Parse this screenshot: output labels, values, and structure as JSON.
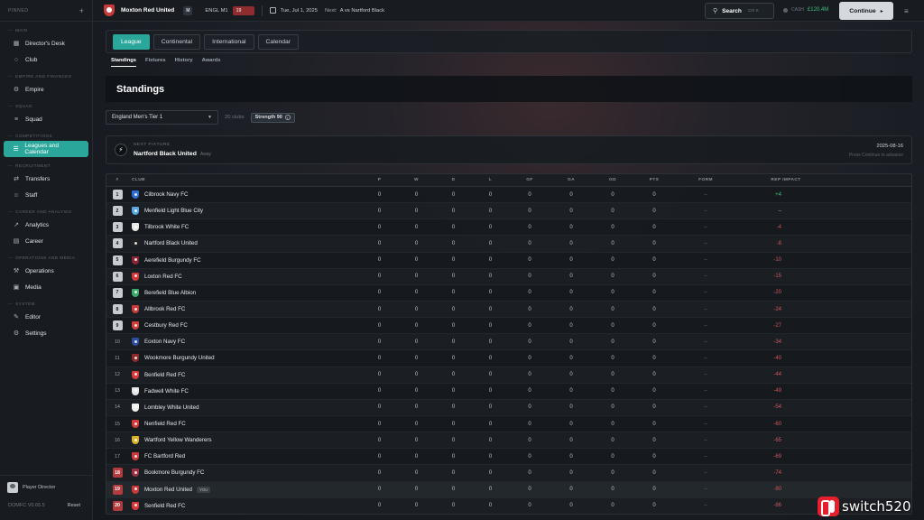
{
  "sidebar": {
    "pinned_label": "PINNED",
    "groups": [
      {
        "section": "MAIN",
        "items": [
          {
            "label": "Director's Desk",
            "icon": "grid-icon"
          },
          {
            "label": "Club",
            "icon": "pin-icon"
          }
        ]
      },
      {
        "section": "EMPIRE AND FINANCES",
        "items": [
          {
            "label": "Empire",
            "icon": "gear-icon"
          }
        ]
      },
      {
        "section": "SQUAD",
        "items": [
          {
            "label": "Squad",
            "icon": "chart-icon"
          }
        ]
      },
      {
        "section": "COMPETITIONS",
        "items": [
          {
            "label": "Leagues and Calendar",
            "icon": "list-icon",
            "active": true
          }
        ]
      },
      {
        "section": "RECRUITMENT",
        "items": [
          {
            "label": "Transfers",
            "icon": "transfer-icon"
          },
          {
            "label": "Staff",
            "icon": "staff-icon"
          }
        ]
      },
      {
        "section": "CAREER AND ANALYSIS",
        "items": [
          {
            "label": "Analytics",
            "icon": "analytics-icon"
          },
          {
            "label": "Career",
            "icon": "career-icon"
          }
        ]
      },
      {
        "section": "OPERATIONS AND MEDIA",
        "items": [
          {
            "label": "Operations",
            "icon": "operations-icon"
          },
          {
            "label": "Media",
            "icon": "media-icon"
          }
        ]
      },
      {
        "section": "SYSTEM",
        "items": [
          {
            "label": "Editor",
            "icon": "edit-icon"
          },
          {
            "label": "Settings",
            "icon": "gear-icon"
          }
        ]
      }
    ],
    "user_name": "Player Director",
    "version": "DOMFC V0.65.5",
    "reset_label": "Reset"
  },
  "topbar": {
    "club": "Moxton Red United",
    "badge": "M",
    "league": "ENGL M1",
    "position": "19",
    "date": "Tue, Jul 1, 2025",
    "next_label": "Next:",
    "next_value": "A  vs Nartford Black",
    "search_label": "Search",
    "search_kbd": "Ctrl K",
    "cash_label": "CASH",
    "cash_value": "£120.4M",
    "continue_label": "Continue"
  },
  "tabs": [
    "League",
    "Continental",
    "International",
    "Calendar"
  ],
  "subtabs": [
    "Standings",
    "Fixtures",
    "History",
    "Awards"
  ],
  "page_title": "Standings",
  "filter": {
    "league": "England Men's Tier 1",
    "clubs": "20 clubs",
    "strength": "Strength 90"
  },
  "fixture": {
    "label": "NEXT FIXTURE",
    "team": "Nartford Black United",
    "venue": "Away",
    "date": "2025-08-16",
    "hint": "Press Continue to advance"
  },
  "table": {
    "headers": {
      "pos": "#",
      "club": "CLUB",
      "p": "P",
      "w": "W",
      "d": "D",
      "l": "L",
      "gf": "GF",
      "ga": "GA",
      "gd": "GD",
      "pts": "PTS",
      "form": "FORM",
      "rep": "REP IMPACT"
    },
    "rows": [
      {
        "pos": "1",
        "zone": "promo",
        "club": "Cilbrook Navy FC",
        "color": "#2c6fd1",
        "p": "0",
        "w": "0",
        "d": "0",
        "l": "0",
        "gf": "0",
        "ga": "0",
        "gd": "0",
        "pts": "0",
        "form": "–",
        "rep": "+4"
      },
      {
        "pos": "2",
        "zone": "promo",
        "club": "Menfield Light Blue City",
        "color": "#5aa7e0",
        "p": "0",
        "w": "0",
        "d": "0",
        "l": "0",
        "gf": "0",
        "ga": "0",
        "gd": "0",
        "pts": "0",
        "form": "–",
        "rep": "–"
      },
      {
        "pos": "3",
        "zone": "promo",
        "club": "Tilbrook White FC",
        "color": "#e8e8e8",
        "p": "0",
        "w": "0",
        "d": "0",
        "l": "0",
        "gf": "0",
        "ga": "0",
        "gd": "0",
        "pts": "0",
        "form": "–",
        "rep": "-4"
      },
      {
        "pos": "4",
        "zone": "promo",
        "club": "Nartford Black United",
        "color": "#222222",
        "p": "0",
        "w": "0",
        "d": "0",
        "l": "0",
        "gf": "0",
        "ga": "0",
        "gd": "0",
        "pts": "0",
        "form": "–",
        "rep": "-8"
      },
      {
        "pos": "5",
        "zone": "promo",
        "club": "Aerefield Burgundy FC",
        "color": "#8a2434",
        "p": "0",
        "w": "0",
        "d": "0",
        "l": "0",
        "gf": "0",
        "ga": "0",
        "gd": "0",
        "pts": "0",
        "form": "–",
        "rep": "-10"
      },
      {
        "pos": "6",
        "zone": "promo",
        "club": "Loxton Red FC",
        "color": "#d23a3a",
        "p": "0",
        "w": "0",
        "d": "0",
        "l": "0",
        "gf": "0",
        "ga": "0",
        "gd": "0",
        "pts": "0",
        "form": "–",
        "rep": "-15"
      },
      {
        "pos": "7",
        "zone": "promo",
        "club": "Berefield Blue Albion",
        "color": "#3ea86a",
        "p": "0",
        "w": "0",
        "d": "0",
        "l": "0",
        "gf": "0",
        "ga": "0",
        "gd": "0",
        "pts": "0",
        "form": "–",
        "rep": "-20"
      },
      {
        "pos": "8",
        "zone": "promo",
        "club": "Allbrook Red FC",
        "color": "#c93a3a",
        "p": "0",
        "w": "0",
        "d": "0",
        "l": "0",
        "gf": "0",
        "ga": "0",
        "gd": "0",
        "pts": "0",
        "form": "–",
        "rep": "-24"
      },
      {
        "pos": "9",
        "zone": "promo",
        "club": "Cestbury Red FC",
        "color": "#d0403a",
        "p": "0",
        "w": "0",
        "d": "0",
        "l": "0",
        "gf": "0",
        "ga": "0",
        "gd": "0",
        "pts": "0",
        "form": "–",
        "rep": "-27"
      },
      {
        "pos": "10",
        "zone": "mid",
        "club": "Eoxton Navy FC",
        "color": "#2b4f9a",
        "p": "0",
        "w": "0",
        "d": "0",
        "l": "0",
        "gf": "0",
        "ga": "0",
        "gd": "0",
        "pts": "0",
        "form": "–",
        "rep": "-34"
      },
      {
        "pos": "11",
        "zone": "mid",
        "club": "Wookmore Burgundy United",
        "color": "#8a2a2a",
        "p": "0",
        "w": "0",
        "d": "0",
        "l": "0",
        "gf": "0",
        "ga": "0",
        "gd": "0",
        "pts": "0",
        "form": "–",
        "rep": "-40"
      },
      {
        "pos": "12",
        "zone": "mid",
        "club": "Benfield Red FC",
        "color": "#d63a3a",
        "p": "0",
        "w": "0",
        "d": "0",
        "l": "0",
        "gf": "0",
        "ga": "0",
        "gd": "0",
        "pts": "0",
        "form": "–",
        "rep": "-44"
      },
      {
        "pos": "13",
        "zone": "mid",
        "club": "Fadwell White FC",
        "color": "#e6e6e6",
        "p": "0",
        "w": "0",
        "d": "0",
        "l": "0",
        "gf": "0",
        "ga": "0",
        "gd": "0",
        "pts": "0",
        "form": "–",
        "rep": "-49"
      },
      {
        "pos": "14",
        "zone": "mid",
        "club": "Lombley White United",
        "color": "#f0f0f0",
        "p": "0",
        "w": "0",
        "d": "0",
        "l": "0",
        "gf": "0",
        "ga": "0",
        "gd": "0",
        "pts": "0",
        "form": "–",
        "rep": "-54"
      },
      {
        "pos": "15",
        "zone": "mid",
        "club": "Nenfield Red FC",
        "color": "#d23a3a",
        "p": "0",
        "w": "0",
        "d": "0",
        "l": "0",
        "gf": "0",
        "ga": "0",
        "gd": "0",
        "pts": "0",
        "form": "–",
        "rep": "-60"
      },
      {
        "pos": "16",
        "zone": "mid",
        "club": "Wartford Yellow Wanderers",
        "color": "#d8b22a",
        "p": "0",
        "w": "0",
        "d": "0",
        "l": "0",
        "gf": "0",
        "ga": "0",
        "gd": "0",
        "pts": "0",
        "form": "–",
        "rep": "-65"
      },
      {
        "pos": "17",
        "zone": "mid",
        "club": "FC Bartford Red",
        "color": "#c93a3a",
        "p": "0",
        "w": "0",
        "d": "0",
        "l": "0",
        "gf": "0",
        "ga": "0",
        "gd": "0",
        "pts": "0",
        "form": "–",
        "rep": "-69"
      },
      {
        "pos": "18",
        "zone": "rel",
        "club": "Bookmore Burgundy FC",
        "color": "#9a3040",
        "p": "0",
        "w": "0",
        "d": "0",
        "l": "0",
        "gf": "0",
        "ga": "0",
        "gd": "0",
        "pts": "0",
        "form": "–",
        "rep": "-74"
      },
      {
        "pos": "19",
        "zone": "rel",
        "club": "Moxton Red United",
        "color": "#c83a3a",
        "you": "YOU",
        "p": "0",
        "w": "0",
        "d": "0",
        "l": "0",
        "gf": "0",
        "ga": "0",
        "gd": "0",
        "pts": "0",
        "form": "–",
        "rep": "-80"
      },
      {
        "pos": "20",
        "zone": "rel",
        "club": "Senfield Red FC",
        "color": "#d63a3a",
        "p": "0",
        "w": "0",
        "d": "0",
        "l": "0",
        "gf": "0",
        "ga": "0",
        "gd": "0",
        "pts": "0",
        "form": "–",
        "rep": "-86"
      }
    ]
  },
  "watermark": "switch520"
}
